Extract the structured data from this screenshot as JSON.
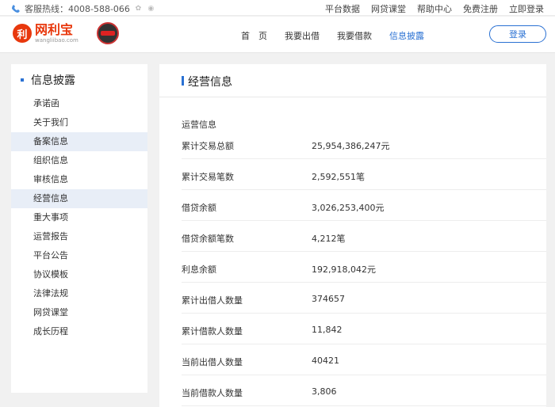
{
  "topbar": {
    "hotline": "客服热线：4008-588-066",
    "links": [
      "平台数据",
      "网贷课堂",
      "帮助中心",
      "免费注册",
      "立即登录"
    ]
  },
  "header": {
    "logo_cn": "网利宝",
    "logo_en": "wangliibao.com",
    "nav": [
      "首　页",
      "我要出借",
      "我要借款",
      "信息披露"
    ],
    "login": "登录"
  },
  "sidebar": {
    "title": "信息披露",
    "items": [
      "承诺函",
      "关于我们",
      "备案信息",
      "组织信息",
      "审核信息",
      "经营信息",
      "重大事项",
      "运营报告",
      "平台公告",
      "协议模板",
      "法律法规",
      "网贷课堂",
      "成长历程"
    ]
  },
  "main": {
    "title": "经营信息",
    "section": "运营信息",
    "rows": [
      {
        "label": "累计交易总额",
        "value": "25,954,386,247元"
      },
      {
        "label": "累计交易笔数",
        "value": "2,592,551笔"
      },
      {
        "label": "借贷余额",
        "value": "3,026,253,400元"
      },
      {
        "label": "借贷余额笔数",
        "value": "4,212笔"
      },
      {
        "label": "利息余额",
        "value": "192,918,042元"
      },
      {
        "label": "累计出借人数量",
        "value": "374657"
      },
      {
        "label": "累计借款人数量",
        "value": "11,842"
      },
      {
        "label": "当前出借人数量",
        "value": "40421"
      },
      {
        "label": "当前借款人数量",
        "value": "3,806"
      }
    ]
  },
  "colors": {
    "accent": "#2a71d3",
    "brand": "#e8380d"
  }
}
